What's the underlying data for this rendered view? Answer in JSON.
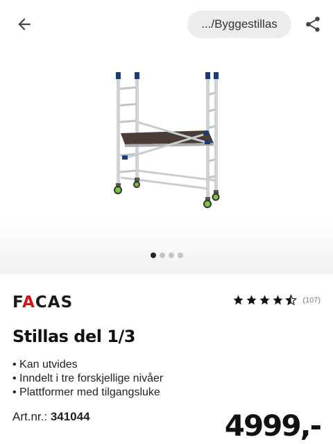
{
  "header": {
    "back_icon": "arrow-left-icon",
    "breadcrumb": ".../Byggestillas",
    "share_icon": "share-icon"
  },
  "gallery": {
    "image_alt": "Aluminium scaffold tower with platform and wheels",
    "slide_count": 4,
    "active_slide": 1
  },
  "product": {
    "brand_prefix": "F",
    "brand_accent": "A",
    "brand_rest": "CAS",
    "rating": 4.5,
    "rating_max": 5,
    "review_count": "(107)",
    "title": "Stillas del 1/3",
    "features": [
      "Kan utvides",
      "Inndelt i tre forskjellige nivåer",
      "Plattformer med tilgangsluke"
    ],
    "artnr_label": "Art.nr.:",
    "artnr_value": "341044",
    "price": "4999,-"
  },
  "colors": {
    "brand_red": "#d0161e",
    "text": "#1a1a1a",
    "pill_bg": "#ececec",
    "dot_active": "#222222",
    "dot_inactive": "#c4c4c4"
  }
}
